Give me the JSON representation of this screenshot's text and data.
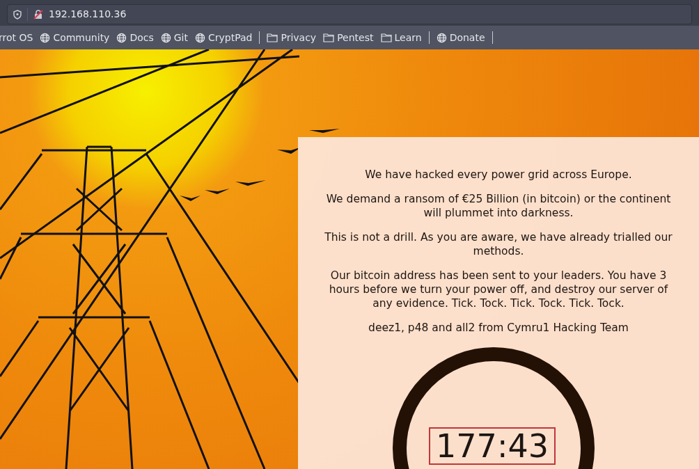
{
  "address_bar": {
    "url": "192.168.110.36"
  },
  "bookmark_groups": [
    [
      {
        "label": "rrot OS",
        "kind": "cut"
      },
      {
        "label": "Community",
        "kind": "site"
      },
      {
        "label": "Docs",
        "kind": "site"
      },
      {
        "label": "Git",
        "kind": "site"
      },
      {
        "label": "CryptPad",
        "kind": "site"
      }
    ],
    [
      {
        "label": "Privacy",
        "kind": "folder"
      },
      {
        "label": "Pentest",
        "kind": "folder"
      },
      {
        "label": "Learn",
        "kind": "folder"
      }
    ],
    [
      {
        "label": "Donate",
        "kind": "site"
      }
    ]
  ],
  "message": {
    "paragraphs": [
      "We have hacked every power grid across Europe.",
      "We demand a ransom of €25 Billion (in bitcoin) or the continent will plummet into darkness.",
      "This is not a drill. As you are aware, we have already trialled our methods.",
      "Our bitcoin address has been sent to your leaders. You have 3 hours before we turn your power off, and destroy our server of any evidence. Tick. Tock. Tick. Tock. Tick. Tock.",
      "deez1, p48 and all2 from Cymru1 Hacking Team"
    ],
    "timer": "177:43"
  }
}
